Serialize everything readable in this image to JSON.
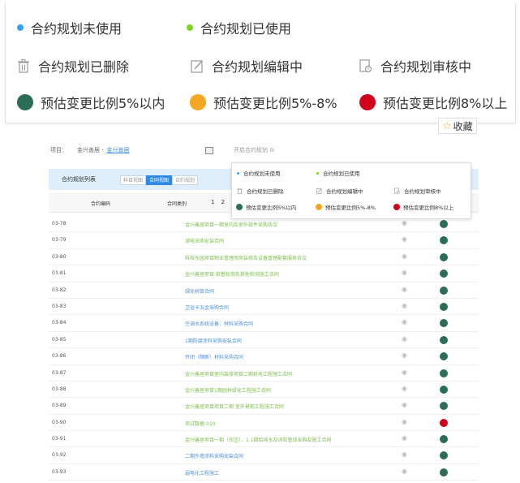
{
  "legend": {
    "unused": {
      "label": "合约规划未使用",
      "color": "#3aa0f0"
    },
    "used": {
      "label": "合约规划已使用",
      "color": "#7ed321"
    },
    "deleted": {
      "label": "合约规划已删除",
      "icon": "trash-icon"
    },
    "editing": {
      "label": "合约规划编辑中",
      "icon": "edit-icon"
    },
    "reviewing": {
      "label": "合约规划审核中",
      "icon": "review-icon"
    },
    "within5": {
      "label": "预估变更比例5%以内",
      "color": "#2a6e55"
    },
    "range5to8": {
      "label": "预估变更比例5%-8%",
      "color": "#f5a623"
    },
    "above8": {
      "label": "预估变更比例8%以上",
      "color": "#d0021b"
    }
  },
  "favorite": {
    "label": "收藏",
    "icon": "star-icon"
  },
  "page": {
    "crumb_prefix": "项目：",
    "crumb_item1": "金兴善居",
    "crumb_item2": "金兴善居",
    "filter_faded": "开启合约规划",
    "section_title": "合约规划列表",
    "tabs": [
      "科目视图",
      "合同视图",
      "合约规划"
    ],
    "col_code": "合约编码",
    "col_name": "合同类别",
    "pager": "1 2 3",
    "rows": [
      {
        "code": "03-78",
        "name": "金兴善居项目一期室内及室外部件采购协议",
        "color": "green",
        "status": "#2a6e55"
      },
      {
        "code": "03-79",
        "name": "湖电采购安装合同",
        "color": "green",
        "status": "#2a6e55"
      },
      {
        "code": "03-80",
        "name": "科技东园项目物业管理用房装修及设备管理配套服务协议",
        "color": "green",
        "status": "#2a6e55"
      },
      {
        "code": "03-81",
        "name": "金兴善居项目 桩基检测及其他检测施工合同",
        "color": "green",
        "status": "#2a6e55"
      },
      {
        "code": "03-82",
        "name": "绿化树苗合同",
        "color": "blue",
        "status": "#2a6e55"
      },
      {
        "code": "03-83",
        "name": "卫浴卡五金采购合同",
        "color": "blue",
        "status": "#2a6e55"
      },
      {
        "code": "03-84",
        "name": "空调水系统设备、材料采购合同",
        "color": "blue",
        "status": "#2a6e55"
      },
      {
        "code": "03-85",
        "name": "1期防腐涂料采购安装合同",
        "color": "blue",
        "status": "#2a6e55"
      },
      {
        "code": "03-86",
        "name": "开闭（隔断）材料采购合同",
        "color": "blue",
        "status": "#2a6e55"
      },
      {
        "code": "03-87",
        "name": "金兴善居项目室内装修项目二期机电工程施工合同",
        "color": "green",
        "status": "#2a6e55"
      },
      {
        "code": "03-88",
        "name": "金兴善居项目1期园林绿化工程施工合同",
        "color": "green",
        "status": "#2a6e55"
      },
      {
        "code": "03-89",
        "name": "金兴善居项目项目二期 室外景观工程施工合同",
        "color": "green",
        "status": "#2a6e55"
      },
      {
        "code": "03-90",
        "name": "测试数据-010",
        "color": "green",
        "status": "#d0021b"
      },
      {
        "code": "03-91",
        "name": "金兴善居项目一期（东区）、1.1期给排水及消防管线采购及施工合同",
        "color": "green",
        "status": "#2a6e55"
      },
      {
        "code": "03-92",
        "name": "二期外墙涂料采购安装合同",
        "color": "blue",
        "status": "#2a6e55"
      },
      {
        "code": "03-93",
        "name": "弱电化工程施工",
        "color": "blue",
        "status": "#2a6e55"
      }
    ]
  }
}
